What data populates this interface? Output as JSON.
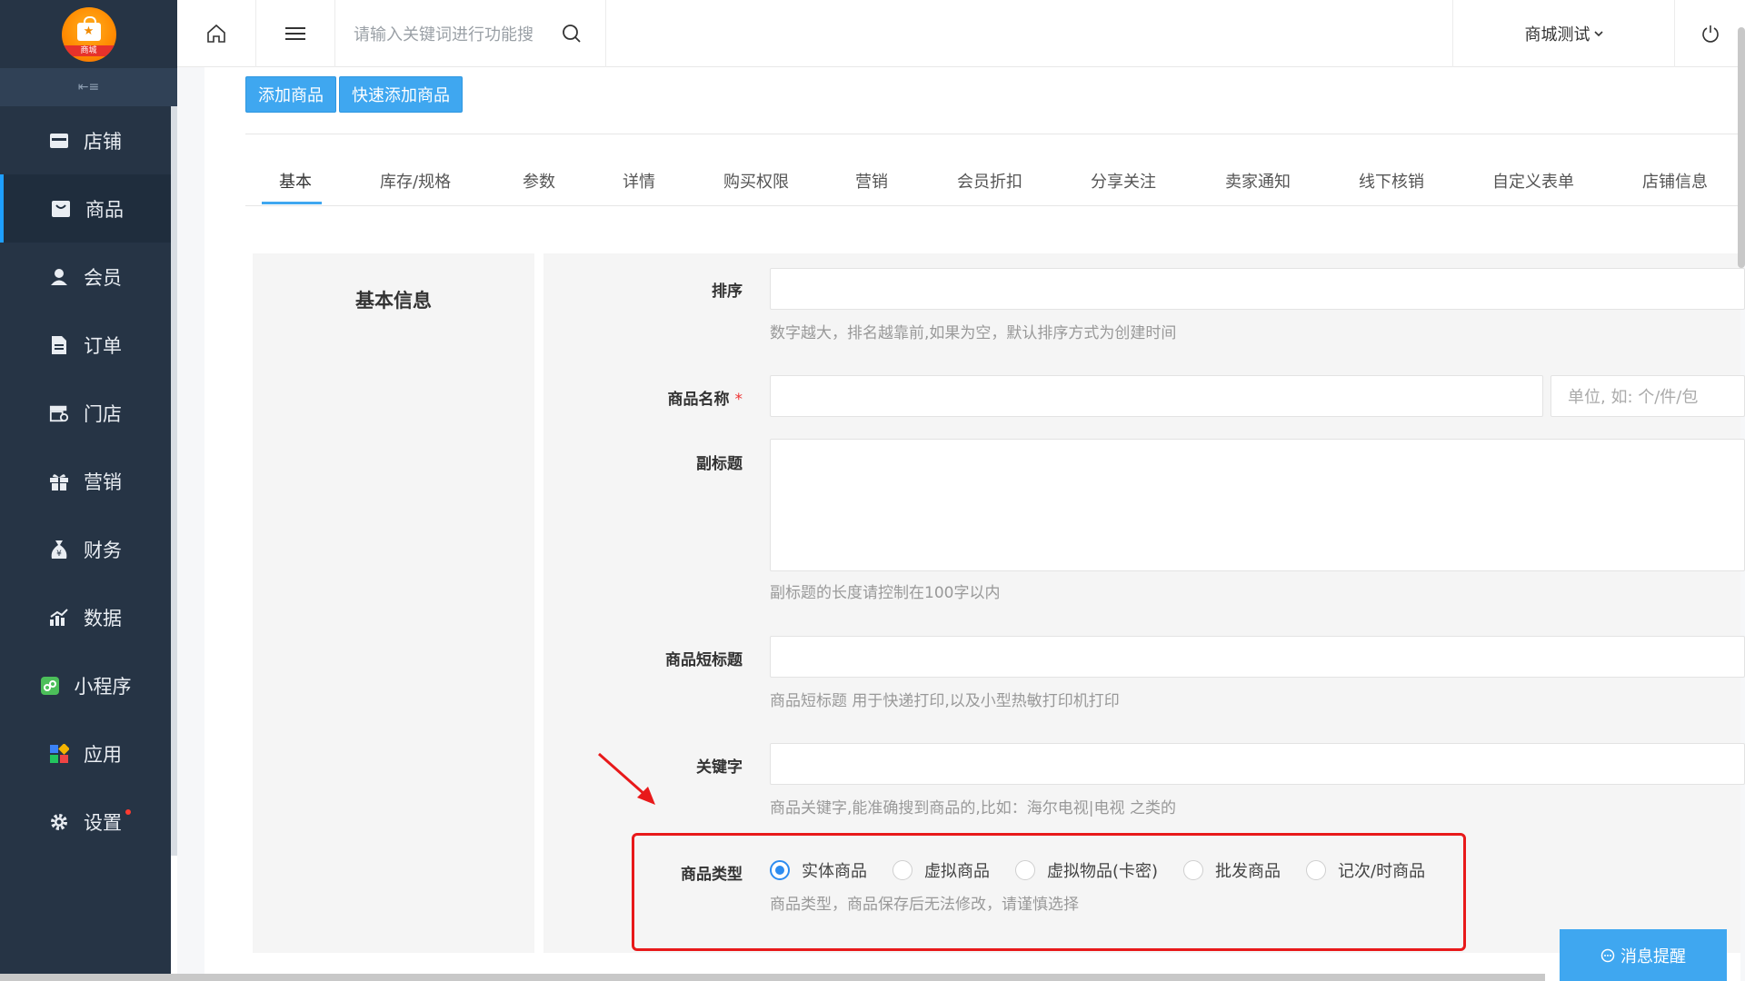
{
  "sidebar": {
    "logo_text": "商城",
    "items": [
      {
        "label": "店铺",
        "icon": "store-icon",
        "active": false
      },
      {
        "label": "商品",
        "icon": "bag-icon",
        "active": true
      },
      {
        "label": "会员",
        "icon": "user-icon",
        "active": false
      },
      {
        "label": "订单",
        "icon": "document-icon",
        "active": false
      },
      {
        "label": "门店",
        "icon": "shop-gear-icon",
        "active": false
      },
      {
        "label": "营销",
        "icon": "gift-icon",
        "active": false
      },
      {
        "label": "财务",
        "icon": "money-bag-icon",
        "active": false
      },
      {
        "label": "数据",
        "icon": "chart-icon",
        "active": false
      },
      {
        "label": "小程序",
        "icon": "miniprogram-icon",
        "active": false
      },
      {
        "label": "应用",
        "icon": "apps-icon",
        "active": false
      },
      {
        "label": "设置",
        "icon": "gear-icon",
        "active": false
      }
    ]
  },
  "topbar": {
    "search_placeholder": "请输入关键词进行功能搜",
    "store_name": "商城测试"
  },
  "actions": {
    "add_product": "添加商品",
    "quick_add_product": "快速添加商品"
  },
  "tabs": [
    "基本",
    "库存/规格",
    "参数",
    "详情",
    "购买权限",
    "营销",
    "会员折扣",
    "分享关注",
    "卖家通知",
    "线下核销",
    "自定义表单",
    "店铺信息"
  ],
  "section_title": "基本信息",
  "form": {
    "sort_label": "排序",
    "sort_hint": "数字越大，排名越靠前,如果为空，默认排序方式为创建时间",
    "name_label": "商品名称",
    "required_mark": "*",
    "unit_placeholder": "单位, 如: 个/件/包",
    "subtitle_label": "副标题",
    "subtitle_hint": "副标题的长度请控制在100字以内",
    "short_title_label": "商品短标题",
    "short_title_hint": "商品短标题 用于快递打印,以及小型热敏打印机打印",
    "keyword_label": "关键字",
    "keyword_hint": "商品关键字,能准确搜到商品的,比如：海尔电视|电视 之类的",
    "type_label": "商品类型",
    "type_options": [
      "实体商品",
      "虚拟商品",
      "虚拟物品(卡密)",
      "批发商品",
      "记次/时商品"
    ],
    "type_selected": "实体商品",
    "type_hint": "商品类型，商品保存后无法修改，请谨慎选择"
  },
  "message_button": "消息提醒",
  "colors": {
    "sidebar_bg": "#263445",
    "accent": "#3fa7f0",
    "highlight": "#e8191a"
  }
}
